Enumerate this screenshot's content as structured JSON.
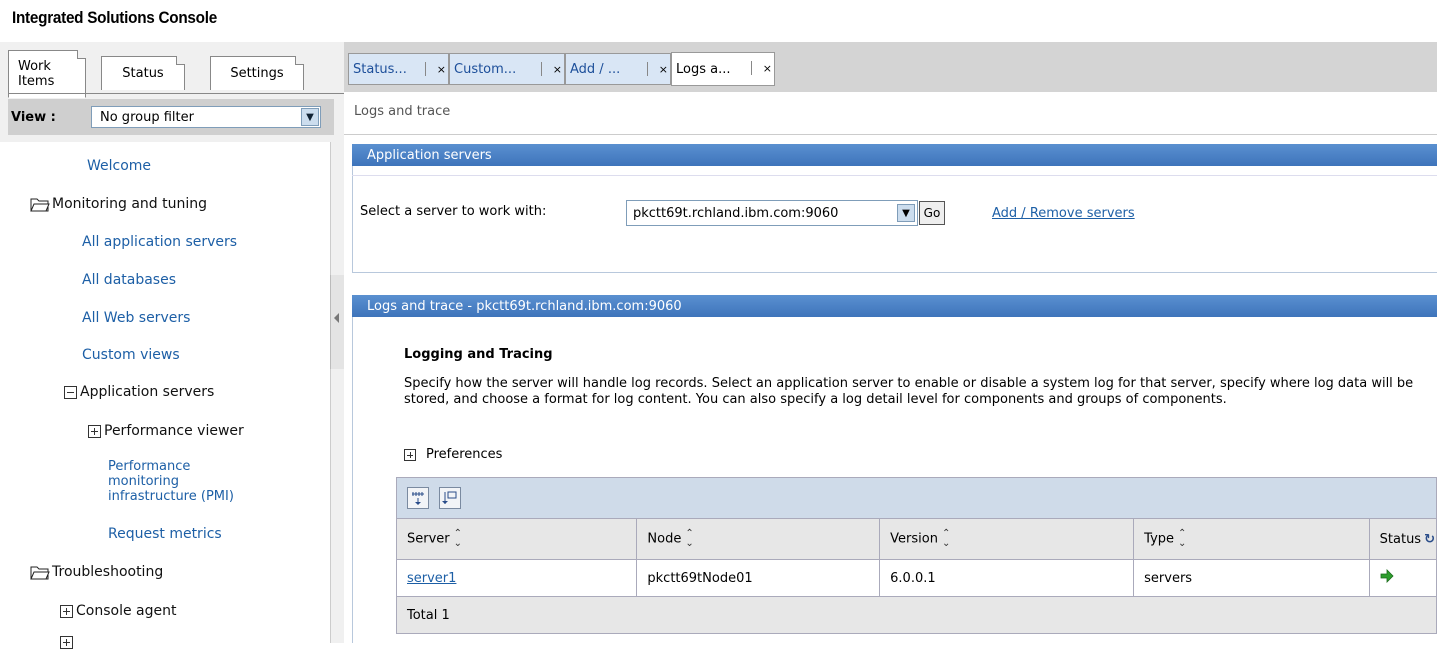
{
  "app_title": "Integrated Solutions Console",
  "left": {
    "tabs": [
      {
        "label": "Work Items",
        "active": true
      },
      {
        "label": "Status"
      },
      {
        "label": "Settings"
      }
    ],
    "view_label": "View :",
    "view_value": "No group filter",
    "nav": {
      "welcome": "Welcome",
      "monitoring": "Monitoring and tuning",
      "all_app_servers": "All application servers",
      "all_databases": "All databases",
      "all_web_servers": "All Web servers",
      "custom_views": "Custom views",
      "application_servers": "Application servers",
      "performance_viewer": "Performance viewer",
      "pmi_line1": "Performance",
      "pmi_line2": "monitoring",
      "pmi_line3": "infrastructure (PMI)",
      "request_metrics": "Request metrics",
      "troubleshooting": "Troubleshooting",
      "console_agent": "Console agent"
    }
  },
  "right": {
    "tabs": [
      {
        "label": "Status..."
      },
      {
        "label": "Custom..."
      },
      {
        "label": "Add / ..."
      },
      {
        "label": "Logs a...",
        "active": true
      }
    ],
    "breadcrumb": "Logs and trace",
    "app_servers_header": "Application servers",
    "select_label": "Select a server to work with:",
    "server_value": "pkctt69t.rchland.ibm.com:9060",
    "go_label": "Go",
    "add_remove_link": "Add / Remove servers",
    "logs_header": "Logs and trace - pkctt69t.rchland.ibm.com:9060",
    "logging_title": "Logging and Tracing",
    "description": "Specify how the server will handle log records. Select an application server to enable or disable a system log for that server, specify where log data will be stored, and choose a format for log content. You can also specify a log detail level for components and groups of components.",
    "preferences": "Preferences",
    "table": {
      "columns": [
        "Server",
        "Node",
        "Version",
        "Type",
        "Status"
      ],
      "rows": [
        {
          "server": "server1",
          "node": "pkctt69tNode01",
          "version": "6.0.0.1",
          "type": "servers",
          "status": "started"
        }
      ],
      "total": "Total 1"
    }
  },
  "colors": {
    "header_blue": "#3e74bb",
    "link_blue": "#1d5fa6",
    "status_green": "#2e9e2e"
  }
}
